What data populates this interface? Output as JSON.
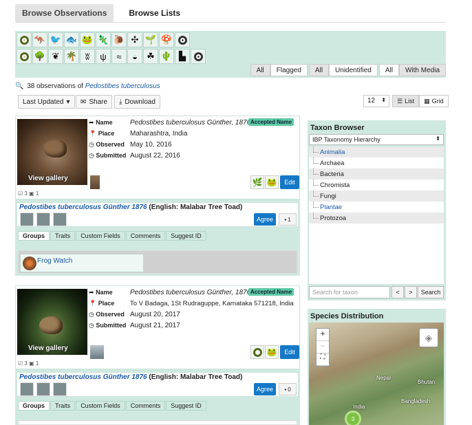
{
  "tabs": [
    "Browse Observations",
    "Browse Lists"
  ],
  "filters": {
    "flag": [
      "All",
      "Flagged"
    ],
    "identified": [
      "All",
      "Unidentified"
    ],
    "media": [
      "All",
      "With Media"
    ]
  },
  "group_icons_row1": [
    "ring-icon",
    "kangaroo-icon",
    "bird-icon",
    "fish-icon",
    "frog-icon",
    "seahorse-icon",
    "snail-icon",
    "dragonfly-icon",
    "plant-icon",
    "mushroom-icon",
    "target-icon"
  ],
  "group_icons_row2": [
    "ring-icon",
    "tree-icon",
    "shrub-icon",
    "palm-icon",
    "grass-icon",
    "reed-icon",
    "water-icon",
    "shell-icon",
    "sprout-icon",
    "cactus-icon",
    "factory-icon",
    "target-icon"
  ],
  "summary": {
    "count": "38 observations of",
    "taxon": "Pedostibes tuberculosus"
  },
  "toolbar": {
    "sort": "Last Updated",
    "share": "Share",
    "download": "Download",
    "per_page": "12",
    "view_list": "List",
    "view_grid": "Grid"
  },
  "field_labels": {
    "name": "Name",
    "place": "Place",
    "observed": "Observed",
    "submitted": "Submitted"
  },
  "observations": [
    {
      "gallery": "View gallery",
      "sp_name": "Pedostibes tuberculosus",
      "sp_author": "Günther, 1876",
      "badge": "Accepted Name",
      "place": "Maharashtra, India",
      "observed": "May 10, 2016",
      "submitted": "August 22, 2016",
      "counts": "3",
      "media_count": "1",
      "edit": "Edit",
      "reco_name": "Pedostibes tuberculosus Günther 1876",
      "reco_common": "(English: Malabar Tree Toad)",
      "agree": "Agree",
      "comments": "1",
      "subtabs": [
        "Groups",
        "Traits",
        "Custom Fields",
        "Comments",
        "Suggest ID"
      ],
      "group": "Frog Watch"
    },
    {
      "gallery": "View gallery",
      "sp_name": "Pedostibes tuberculosus",
      "sp_author": "Günther, 1876",
      "badge": "Accepted Name",
      "place": "To V Badaga, 1St Rudraguppe, Karnataka 571218, India",
      "observed": "August 20, 2017",
      "submitted": "August 21, 2017",
      "counts": "3",
      "media_count": "1",
      "edit": "Edit",
      "reco_name": "Pedostibes tuberculosus Günther 1876",
      "reco_common": "(English: Malabar Tree Toad)",
      "agree": "Agree",
      "comments": "0",
      "subtabs": [
        "Groups",
        "Traits",
        "Custom Fields",
        "Comments",
        "Suggest ID"
      ]
    }
  ],
  "taxon_browser": {
    "title": "Taxon Browser",
    "hierarchy": "IBP Taxonomy Hierarchy",
    "items": [
      "Animalia",
      "Archaea",
      "Bacteria",
      "Chromista",
      "Fungi",
      "Plantae",
      "Protozoa"
    ],
    "search_placeholder": "Search for taxon",
    "prev": "<",
    "next": ">",
    "search": "Search"
  },
  "distribution": {
    "title": "Species Distribution",
    "labels": [
      "Nepal",
      "Bhutan",
      "India",
      "Bangladesh"
    ],
    "cluster": "3",
    "zoom_in": "+",
    "zoom_out": "−"
  }
}
